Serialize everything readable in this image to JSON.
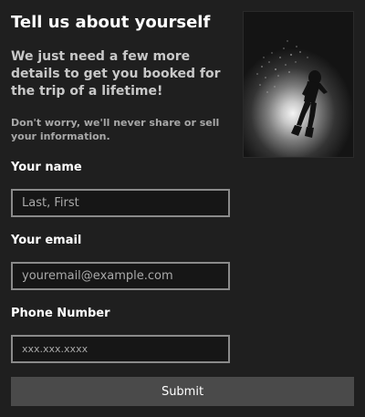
{
  "header": {
    "title": "Tell us about yourself",
    "subtitle": "We just need a few more details to get you booked for the trip of a lifetime!",
    "privacy_note": "Don't worry, we'll never share or sell your information."
  },
  "form": {
    "name": {
      "label": "Your name",
      "value": "",
      "placeholder": "Last, First"
    },
    "email": {
      "label": "Your email",
      "value": "",
      "placeholder": "youremail@example.com"
    },
    "phone": {
      "label": "Phone Number",
      "value": "",
      "placeholder": "xxx.xxx.xxxx"
    },
    "submit_label": "Submit"
  },
  "images": {
    "hero": "scuba-diver-silhouette-photo"
  },
  "colors": {
    "background": "#1f1f1f",
    "input_border": "#8a8a8a",
    "button": "#4a4a4a"
  }
}
